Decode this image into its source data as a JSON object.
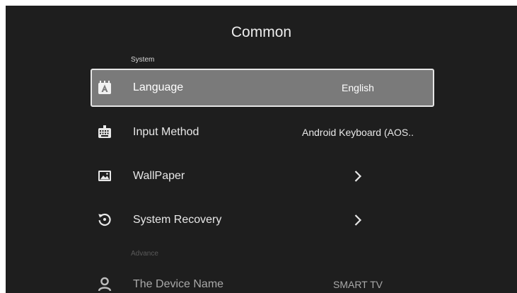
{
  "page": {
    "title": "Common",
    "sections": {
      "system": "System",
      "advance": "Advance"
    }
  },
  "settings": [
    {
      "label": "Language",
      "value": "English",
      "icon": "language-icon"
    },
    {
      "label": "Input Method",
      "value": "Android Keyboard (AOS..",
      "icon": "keyboard-icon"
    },
    {
      "label": "WallPaper",
      "value": "›",
      "icon": "image-icon"
    },
    {
      "label": "System Recovery",
      "value": "›",
      "icon": "restore-icon"
    },
    {
      "label": "The Device Name",
      "value": "SMART TV",
      "icon": "person-icon"
    }
  ],
  "colors": {
    "background": "#1e1e1e",
    "focus_fill": "#7a7a7a",
    "focus_border": "#e6e6e6",
    "text": "#e8e8e8"
  }
}
